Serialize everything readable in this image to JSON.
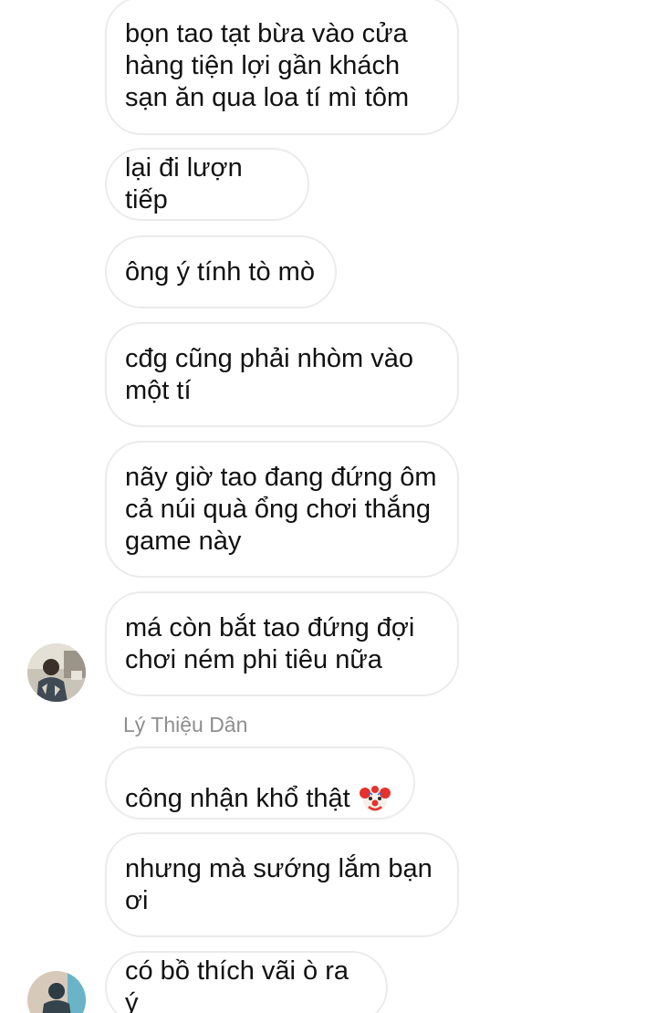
{
  "messages": [
    {
      "text": "bọn tao tạt bừa vào cửa\nhàng tiện lợi gần khách\nsạn ăn qua loa tí mì tôm"
    },
    {
      "text": "lại đi lượn tiếp"
    },
    {
      "text": "ông ý tính tò mò"
    },
    {
      "text": "cđg cũng phải nhòm vào\nmột tí"
    },
    {
      "text": "nãy giờ tao đang đứng ôm\ncả núi quà ổng chơi thắng\ngame này"
    },
    {
      "text": "má còn bắt tao đứng đợi\nchơi ném phi tiêu nữa"
    },
    {
      "text": "công nhận khổ thật",
      "emoji": "clown-face"
    },
    {
      "text": "nhưng mà sướng lắm bạn\nơi"
    },
    {
      "text": "có bồ thích vãi ò ra ý"
    }
  ],
  "sender_name": "Lý Thiệu Dân",
  "colors": {
    "bubble_border": "#ebebeb",
    "text": "#111111",
    "sender_name": "#8e8e8e"
  }
}
